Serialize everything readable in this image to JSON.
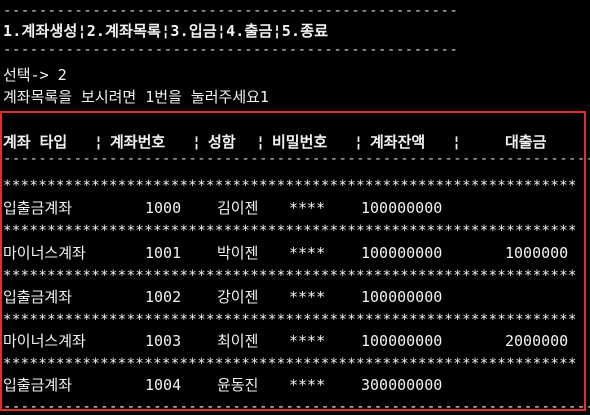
{
  "console": {
    "rule_top": "---------------------------------------------------",
    "menu": "1.계좌생성¦2.계좌목록¦3.입금¦4.출금¦5.종료",
    "rule_mid": "---------------------------------------------------",
    "prompt": "선택-> 2",
    "instruction": "계좌목록을 보시려면 1번을 눌러주세요1"
  },
  "table": {
    "headers": {
      "type": "계좌 타입",
      "sep1": "¦",
      "number": "계좌번호",
      "sep2": "¦",
      "name": "성함",
      "sep3": "¦",
      "password": "비밀번호",
      "sep4": "¦",
      "balance": "계좌잔액",
      "sep5": "¦",
      "loan": "대출금"
    },
    "rule": "---------------------------------------------------------------------",
    "stars": "*****************************************************************",
    "rows": [
      {
        "type": "입출금계좌",
        "number": "1000",
        "name": "김이젠",
        "password": "****",
        "balance": "100000000",
        "loan": ""
      },
      {
        "type": "마이너스계좌",
        "number": "1001",
        "name": "박이젠",
        "password": "****",
        "balance": "100000000",
        "loan": "1000000"
      },
      {
        "type": "입출금계좌",
        "number": "1002",
        "name": "강이젠",
        "password": "****",
        "balance": "100000000",
        "loan": ""
      },
      {
        "type": "마이너스계좌",
        "number": "1003",
        "name": "최이젠",
        "password": "****",
        "balance": "100000000",
        "loan": "2000000"
      },
      {
        "type": "입출금계좌",
        "number": "1004",
        "name": "윤동진",
        "password": "****",
        "balance": "300000000",
        "loan": ""
      }
    ]
  },
  "accent_color": "#e0302a"
}
